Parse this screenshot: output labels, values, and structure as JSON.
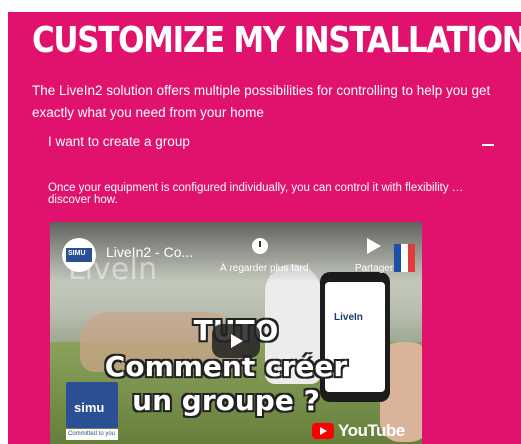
{
  "colors": {
    "brand_magenta": "#e0126d",
    "text_white": "#ffffff",
    "simu_blue": "#2a4f95",
    "youtube_red": "#ff0000"
  },
  "page": {
    "title": "CUSTOMIZE MY INSTALLATION",
    "intro": "The LiveIn2 solution offers multiple possibilities for controlling to help you get exactly what you need from your home"
  },
  "accordion": {
    "title": "I want to create a group",
    "toggle_icon": "minus-icon",
    "body": "Once your equipment is configured individually, you can control it with flexibility … discover how."
  },
  "video": {
    "title": "LiveIn2 - Co...",
    "watermark": "LiveIn",
    "watch_later_label": "À regarder plus tard",
    "share_label": "Partager",
    "phone_app_label": "LiveIn",
    "overlay_lines": [
      "TUTO",
      "Comment créer",
      "un groupe ?"
    ],
    "channel_logo_text": "SIMU",
    "brand_logo_text": "simu",
    "brand_tagline": "Committed to you",
    "platform_label": "YouTube",
    "icons": {
      "watch_later": "clock-icon",
      "share": "share-arrow-icon",
      "play": "play-icon",
      "language": "french-flag-icon"
    }
  }
}
